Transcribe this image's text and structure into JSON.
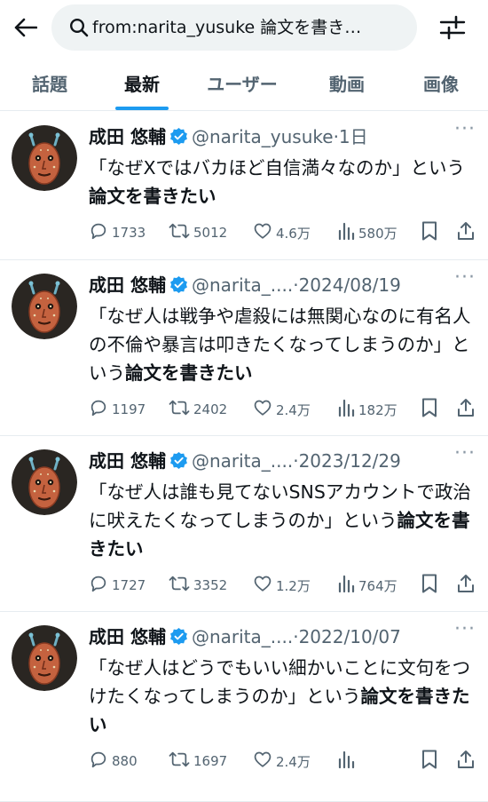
{
  "search": {
    "query": "from:narita_yusuke 論文を書き…"
  },
  "tabs": [
    {
      "label": "話題",
      "active": false
    },
    {
      "label": "最新",
      "active": true
    },
    {
      "label": "ユーザー",
      "active": false
    },
    {
      "label": "動画",
      "active": false
    },
    {
      "label": "画像",
      "active": false
    }
  ],
  "colors": {
    "accent": "#1d9bf0",
    "text": "#0f1419",
    "muted": "#536471"
  },
  "tweets": [
    {
      "name": "成田 悠輔",
      "handle": "@narita_yusuke",
      "dot": "·",
      "date": "1日",
      "text_plain": "「なぜXではバカほど自信満々なのか」という",
      "text_bold": "論文を書きたい",
      "replies": "1733",
      "retweets": "5012",
      "likes": "4.6万",
      "views": "580万"
    },
    {
      "name": "成田 悠輔",
      "handle": "@narita_....",
      "dot": "·",
      "date": "2024/08/19",
      "text_plain": "「なぜ人は戦争や虐殺には無関心なのに有名人の不倫や暴言は叩きたくなってしまうのか」という",
      "text_bold": "論文を書きたい",
      "replies": "1197",
      "retweets": "2402",
      "likes": "2.4万",
      "views": "182万"
    },
    {
      "name": "成田 悠輔",
      "handle": "@narita_....",
      "dot": "·",
      "date": "2023/12/29",
      "text_plain": "「なぜ人は誰も見てないSNSアカウントで政治に吠えたくなってしまうのか」という",
      "text_bold": "論文を書きたい",
      "replies": "1727",
      "retweets": "3352",
      "likes": "1.2万",
      "views": "764万"
    },
    {
      "name": "成田 悠輔",
      "handle": "@narita_....",
      "dot": "·",
      "date": "2022/10/07",
      "text_plain": "「なぜ人はどうでもいい細かいことに文句をつけたくなってしまうのか」という",
      "text_bold": "論文を書きたい",
      "replies": "880",
      "retweets": "1697",
      "likes": "2.4万",
      "views": ""
    }
  ]
}
